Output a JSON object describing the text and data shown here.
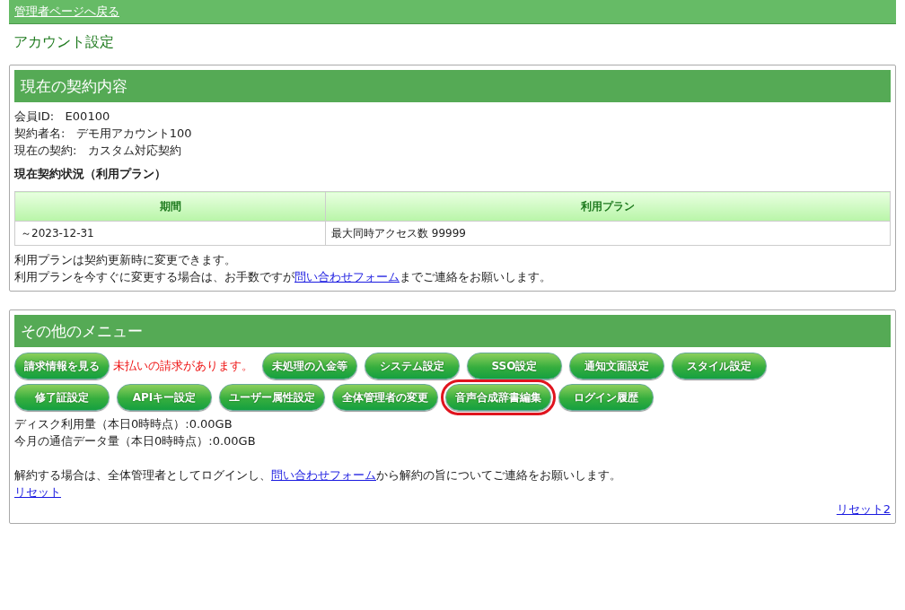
{
  "top_bar": {
    "back_link": "管理者ページへ戻る"
  },
  "page_title": "アカウント設定",
  "contract_panel": {
    "title": "現在の契約内容",
    "fields": [
      {
        "label": "会員ID:",
        "value": "E00100"
      },
      {
        "label": "契約者名:",
        "value": "デモ用アカウント100"
      },
      {
        "label": "現在の契約:",
        "value": "カスタム対応契約"
      }
    ],
    "status_heading": "現在契約状況（利用プラン）",
    "table": {
      "columns": [
        "期間",
        "利用プラン"
      ],
      "rows": [
        [
          "～2023-12-31",
          "最大同時アクセス数 99999"
        ]
      ]
    },
    "note": "利用プランは契約更新時に変更できます。",
    "contact_note": {
      "before": "利用プランを今すぐに変更する場合は、お手数ですが",
      "link": "問い合わせフォーム",
      "after": "までご連絡をお願いします。"
    }
  },
  "menu_panel": {
    "title": "その他のメニュー",
    "rows": [
      [
        {
          "kind": "button",
          "label": "請求情報を見る",
          "highlighted": false
        },
        {
          "kind": "notice",
          "label": "未払いの請求があります。"
        },
        {
          "kind": "button",
          "label": "未処理の入金等",
          "highlighted": false
        },
        {
          "kind": "button",
          "label": "システム設定",
          "highlighted": false
        },
        {
          "kind": "button",
          "label": "SSO設定",
          "highlighted": false
        },
        {
          "kind": "button",
          "label": "通知文面設定",
          "highlighted": false
        },
        {
          "kind": "button",
          "label": "スタイル設定",
          "highlighted": false
        }
      ],
      [
        {
          "kind": "button",
          "label": "修了証設定",
          "highlighted": false
        },
        {
          "kind": "button",
          "label": "APIキー設定",
          "highlighted": false
        },
        {
          "kind": "button",
          "label": "ユーザー属性設定",
          "highlighted": false
        },
        {
          "kind": "button",
          "label": "全体管理者の変更",
          "highlighted": false
        },
        {
          "kind": "button",
          "label": "音声合成辞書編集",
          "highlighted": true
        },
        {
          "kind": "button",
          "label": "ログイン履歴",
          "highlighted": false
        }
      ]
    ],
    "usage": [
      "ディスク利用量（本日0時時点）:0.00GB",
      "今月の通信データ量（本日0時時点）:0.00GB"
    ],
    "cancel_note": {
      "before": "解約する場合は、全体管理者としてログインし、",
      "link": "問い合わせフォーム",
      "after": "から解約の旨についてご連絡をお願いします。"
    },
    "reset_link": "リセット",
    "reset2_link": "リセット2"
  }
}
